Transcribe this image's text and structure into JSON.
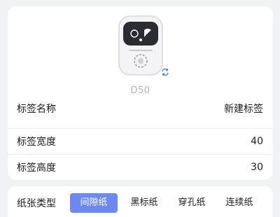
{
  "device": {
    "model": "D50",
    "image_icon": "label-printer-icon",
    "sync_icon": "sync-icon"
  },
  "fields": [
    {
      "label": "标签名称",
      "value": "新建标签"
    },
    {
      "label": "标签宽度",
      "value": "40"
    },
    {
      "label": "标签高度",
      "value": "30"
    }
  ],
  "paper_type": {
    "label": "纸张类型",
    "options": [
      "间隙纸",
      "黑标纸",
      "穿孔纸",
      "连续纸"
    ],
    "selected": "间隙纸"
  },
  "colors": {
    "accent": "#6c89f2",
    "background": "#f1f2f6",
    "card": "#ffffff"
  }
}
